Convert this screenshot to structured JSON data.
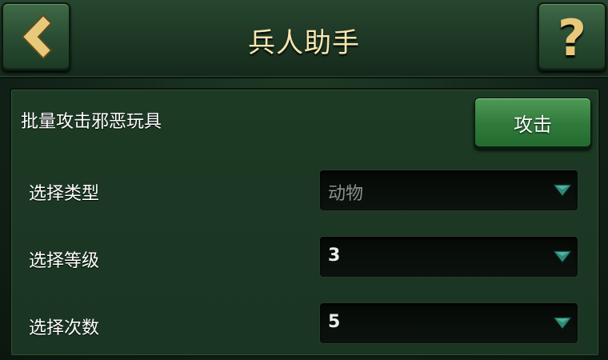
{
  "header": {
    "title": "兵人助手",
    "help_glyph": "?"
  },
  "panel": {
    "batch_label": "批量攻击邪恶玩具",
    "attack_button": "攻击",
    "rows": [
      {
        "label": "选择类型",
        "value": "动物"
      },
      {
        "label": "选择等级",
        "value": "3"
      },
      {
        "label": "选择次数",
        "value": "5"
      }
    ]
  },
  "icons": {
    "back": "chevron-left-icon",
    "help": "question-mark-icon",
    "dropdown": "triangle-down-icon"
  },
  "colors": {
    "title": "#f6e7b0",
    "accent_green": "#2f7a3a",
    "arrow_teal": "#2e8a7a",
    "gold": "#e8c879"
  }
}
